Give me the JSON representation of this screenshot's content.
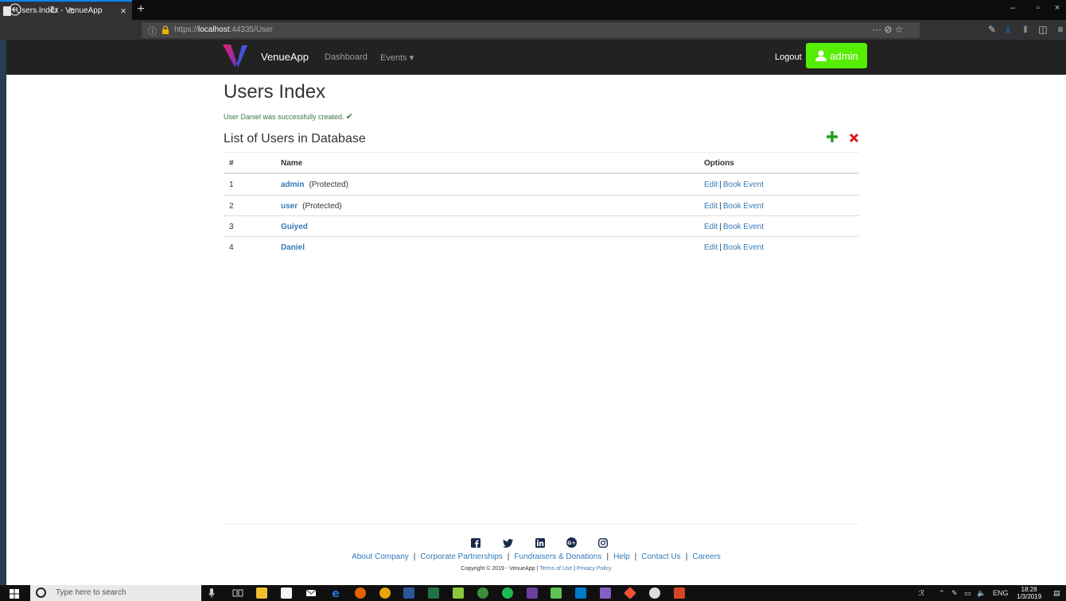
{
  "browser": {
    "tab_title": "Users Index - VenueApp",
    "tab_close": "×",
    "new_tab": "+",
    "url_prefix": "https://",
    "url_host": "localhost",
    "url_rest": ":44335/User",
    "url_actions": "··· ⊘ ☆"
  },
  "nav": {
    "brand": "VenueApp",
    "dashboard": "Dashboard",
    "events": "Events ▾",
    "logout": "Logout",
    "user": "admin"
  },
  "main": {
    "title": "Users Index",
    "success_message": "User Daniel was successfully created.",
    "list_heading": "List of Users in Database",
    "table": {
      "headers": [
        "#",
        "Name",
        "Options"
      ],
      "rows": [
        {
          "num": "1",
          "name": "admin",
          "note": "(Protected)"
        },
        {
          "num": "2",
          "name": "user",
          "note": "(Protected)"
        },
        {
          "num": "3",
          "name": "Guiyed",
          "note": ""
        },
        {
          "num": "4",
          "name": "Daniel",
          "note": ""
        }
      ],
      "edit_label": "Edit",
      "separator": "|",
      "book_label": "Book Event"
    }
  },
  "footer": {
    "links": [
      "About Company",
      "Corporate Partnerships",
      "Fundraisers & Donations",
      "Help",
      "Contact Us",
      "Careers"
    ],
    "copyright": "Copyright © 2019 - VenueApp |",
    "terms": "Terms of Use",
    "privacy": "Privacy Policy"
  },
  "taskbar": {
    "search_placeholder": "Type here to search",
    "lang": "ENG",
    "time": "18:28",
    "date": "1/3/2019"
  },
  "colors": {
    "nav_bg": "#222222",
    "admin_button": "#55ee00",
    "link": "#337ab7",
    "success": "#3c763d",
    "add": "#1e9d1e",
    "delete": "#e0181b"
  }
}
